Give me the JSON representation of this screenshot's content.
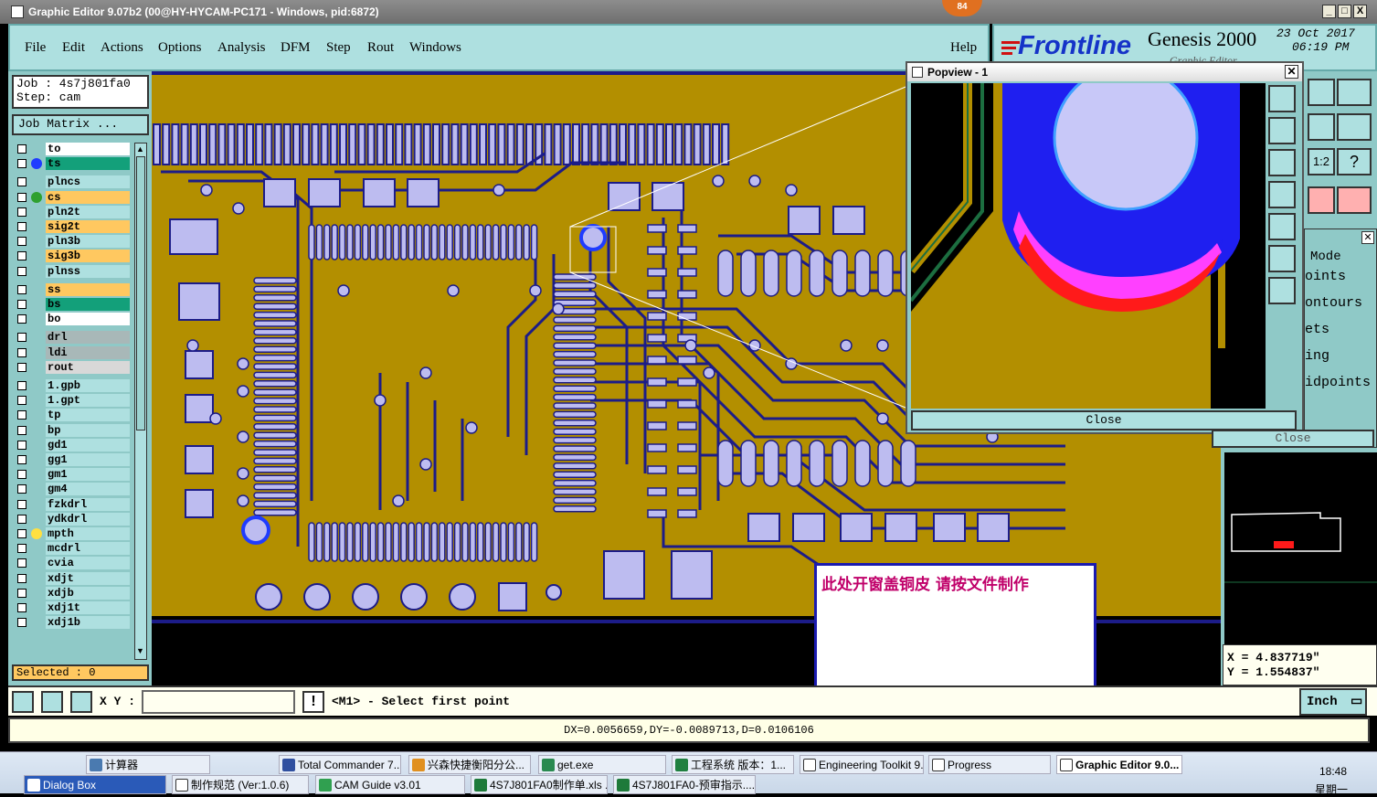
{
  "window": {
    "title": "Graphic Editor 9.07b2 (00@HY-HYCAM-PC171 - Windows, pid:6872)",
    "badge": "84",
    "controls": [
      "_",
      "□",
      "X"
    ]
  },
  "menu": {
    "items": [
      "File",
      "Edit",
      "Actions",
      "Options",
      "Analysis",
      "DFM",
      "Step",
      "Rout",
      "Windows"
    ],
    "help": "Help"
  },
  "brand": {
    "logo": "Frontline",
    "product": "Genesis 2000",
    "date": "23 Oct 2017",
    "time": "06:19 PM",
    "subtitle": "Graphic Editor"
  },
  "job": {
    "job_label": "Job : 4s7j801fa0",
    "step_label": "Step: cam",
    "matrix_button": "Job Matrix ..."
  },
  "layers": [
    {
      "name": "to",
      "color": "#ffffff",
      "dot": ""
    },
    {
      "name": "ts",
      "color": "#13a07a",
      "dot": "#1f3cff"
    },
    {
      "name": "plncs",
      "color": "#aee0e0",
      "dot": ""
    },
    {
      "name": "cs",
      "color": "#ffc860",
      "dot": "#2fa030"
    },
    {
      "name": "pln2t",
      "color": "#aee0e0",
      "dot": ""
    },
    {
      "name": "sig2t",
      "color": "#ffc860",
      "dot": ""
    },
    {
      "name": "pln3b",
      "color": "#aee0e0",
      "dot": ""
    },
    {
      "name": "sig3b",
      "color": "#ffc860",
      "dot": ""
    },
    {
      "name": "plnss",
      "color": "#aee0e0",
      "dot": ""
    },
    {
      "name": "ss",
      "color": "#ffc860",
      "dot": ""
    },
    {
      "name": "bs",
      "color": "#13a07a",
      "dot": ""
    },
    {
      "name": "bo",
      "color": "#ffffff",
      "dot": ""
    },
    {
      "name": "drl",
      "color": "#a8b8b8",
      "dot": ""
    },
    {
      "name": "ldi",
      "color": "#a8b8b8",
      "dot": ""
    },
    {
      "name": "rout",
      "color": "#d8d8d8",
      "dot": ""
    },
    {
      "name": "1.gpb",
      "color": "#aee0e0",
      "dot": ""
    },
    {
      "name": "1.gpt",
      "color": "#aee0e0",
      "dot": ""
    },
    {
      "name": "tp",
      "color": "#aee0e0",
      "dot": ""
    },
    {
      "name": "bp",
      "color": "#aee0e0",
      "dot": ""
    },
    {
      "name": "gd1",
      "color": "#aee0e0",
      "dot": ""
    },
    {
      "name": "gg1",
      "color": "#aee0e0",
      "dot": ""
    },
    {
      "name": "gm1",
      "color": "#aee0e0",
      "dot": ""
    },
    {
      "name": "gm4",
      "color": "#aee0e0",
      "dot": ""
    },
    {
      "name": "fzkdrl",
      "color": "#aee0e0",
      "dot": ""
    },
    {
      "name": "ydkdrl",
      "color": "#aee0e0",
      "dot": ""
    },
    {
      "name": "mpth",
      "color": "#aee0e0",
      "dot": "#ffe040"
    },
    {
      "name": "mcdrl",
      "color": "#aee0e0",
      "dot": ""
    },
    {
      "name": "cvia",
      "color": "#aee0e0",
      "dot": ""
    },
    {
      "name": "xdjt",
      "color": "#aee0e0",
      "dot": ""
    },
    {
      "name": "xdjb",
      "color": "#aee0e0",
      "dot": ""
    },
    {
      "name": "xdj1t",
      "color": "#aee0e0",
      "dot": ""
    },
    {
      "name": "xdj1b",
      "color": "#aee0e0",
      "dot": ""
    }
  ],
  "selected": "Selected : 0",
  "popview": {
    "title": "Popview - 1",
    "close_label": "Close"
  },
  "right_panel": {
    "mode_label": "Mode",
    "items": [
      "oints",
      "ontours",
      "ets",
      "ing",
      "idpoints"
    ],
    "close_label": "Close",
    "x_readout": "X = 4.837719\"",
    "y_readout": "Y = 1.554837\""
  },
  "annotation": {
    "text": "此处开窗盖铜皮   请按文件制作"
  },
  "status": {
    "xy_label": "X Y :",
    "xy_value": "",
    "prompt": "<M1> - Select first point",
    "units": "Inch",
    "measure": "DX=0.0056659,DY=-0.0089713,D=0.0106106"
  },
  "taskbar": {
    "row1": [
      "计算器",
      "Total Commander 7....",
      "兴森快捷衡阳分公...",
      "get.exe",
      "工程系统  版本：1...",
      "Engineering Toolkit 9...",
      "Progress",
      "Graphic Editor 9.0..."
    ],
    "row2": [
      "Dialog Box",
      "制作规范 (Ver:1.0.6)",
      "CAM  Guide v3.01",
      "4S7J801FA0制作单.xls ...",
      "4S7J801FA0-预审指示...."
    ],
    "clock_time": "18:48",
    "clock_day": "星期一"
  },
  "colors": {
    "copper": "#b38f00",
    "trace": "#1c1c88",
    "pad": "#bdbcf0",
    "panel": "#8fc9c7",
    "menu": "#aee0e0"
  }
}
